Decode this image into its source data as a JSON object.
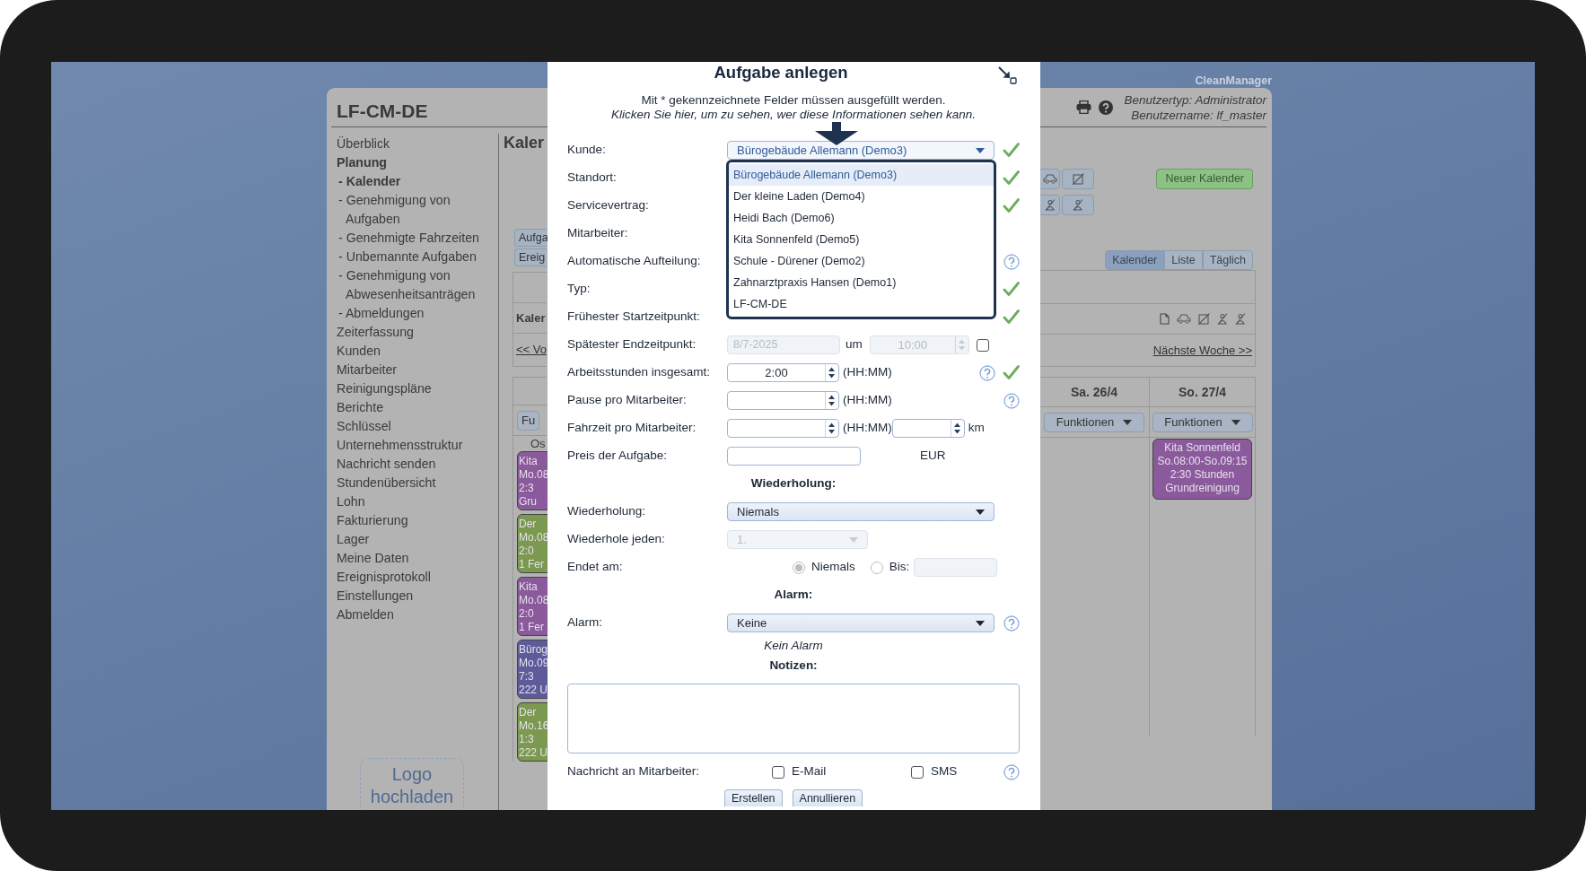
{
  "frame": {
    "brand": "CleanManager"
  },
  "app": {
    "title": "LF-CM-DE",
    "user_type": "Benutzertyp: Administrator",
    "user_name": "Benutzername: lf_master",
    "sidebar": {
      "items": [
        {
          "label": "Überblick",
          "selected": false
        },
        {
          "label": "Planung",
          "selected": true,
          "children": [
            {
              "label": "- Kalender",
              "selected": true
            },
            {
              "label": "- Genehmigung von Aufgaben",
              "selected": false
            },
            {
              "label": "- Genehmigte Fahrzeiten",
              "selected": false
            },
            {
              "label": "- Unbemannte Aufgaben",
              "selected": false
            },
            {
              "label": "- Genehmigung von Abwesenheitsanträgen",
              "selected": false
            },
            {
              "label": "- Abmeldungen",
              "selected": false
            }
          ]
        },
        {
          "label": "Zeiterfassung",
          "selected": false
        },
        {
          "label": "Kunden",
          "selected": false
        },
        {
          "label": "Mitarbeiter",
          "selected": false
        },
        {
          "label": "Reinigungspläne",
          "selected": false
        },
        {
          "label": "Berichte",
          "selected": false
        },
        {
          "label": "Schlüssel",
          "selected": false
        },
        {
          "label": "Unternehmensstruktur",
          "selected": false
        },
        {
          "label": "Nachricht senden",
          "selected": false
        },
        {
          "label": "Stundenübersicht",
          "selected": false
        },
        {
          "label": "Lohn",
          "selected": false
        },
        {
          "label": "Fakturierung",
          "selected": false
        },
        {
          "label": "Lager",
          "selected": false
        },
        {
          "label": "Meine Daten",
          "selected": false
        },
        {
          "label": "Ereignisprotokoll",
          "selected": false
        },
        {
          "label": "Einstellungen",
          "selected": false
        },
        {
          "label": "Abmelden",
          "selected": false
        }
      ],
      "logo_upload": "Logo hochladen"
    },
    "calendar_left": {
      "title": "Kaler",
      "buttons": [
        "Aufga",
        "Ereig"
      ],
      "subtitle": "Kaler",
      "prev_link": "<< Vo",
      "day_menu": "Fu",
      "row_label": "Os",
      "events": [
        {
          "lines": [
            "Kita",
            "Mo.08",
            "2:3",
            "Gru"
          ],
          "color": "#8b5a9c"
        },
        {
          "lines": [
            "Der",
            "Mo.08",
            "2:0",
            "1 Fer"
          ],
          "color": "#7b9950"
        },
        {
          "lines": [
            "Kita",
            "Mo.08",
            "2:0",
            "1 Fer"
          ],
          "color": "#8b5a9c"
        },
        {
          "lines": [
            "Bürog",
            "Mo.09",
            "7:3",
            "222 U"
          ],
          "color": "#5e5b9b"
        },
        {
          "lines": [
            "Der",
            "Mo.16",
            "1:3",
            "222 U"
          ],
          "color": "#7b9950"
        }
      ]
    },
    "calendar_right": {
      "new_calendar": "Neuer Kalender",
      "view_tabs": [
        {
          "label": "Kalender",
          "selected": true
        },
        {
          "label": "Liste",
          "selected": false
        },
        {
          "label": "Täglich",
          "selected": false
        }
      ],
      "next_link": "Nächste Woche >>",
      "days": [
        {
          "header": "Sa. 26/4",
          "menu": "Funktionen"
        },
        {
          "header": "So. 27/4",
          "menu": "Funktionen",
          "events": [
            {
              "lines": [
                "Kita Sonnenfeld",
                "So.08:00-So.09:15",
                "2:30 Stunden",
                "Grundreinigung"
              ],
              "color": "#8b5a9c"
            }
          ]
        }
      ]
    }
  },
  "dialog": {
    "title": "Aufgabe anlegen",
    "note": "Mit * gekennzeichnete Felder müssen ausgefüllt werden.",
    "visibility_link": "Klicken Sie hier, um zu sehen, wer diese Informationen sehen kann.",
    "fields": [
      {
        "kind": "select",
        "label": "Kunde:",
        "value": "Bürogebäude Allemann (Demo3)",
        "open": true,
        "valid": true,
        "options": [
          {
            "label": "Bürogebäude Allemann (Demo3)",
            "selected": true
          },
          {
            "label": "Der kleine Laden (Demo4)",
            "selected": false
          },
          {
            "label": "Heidi Bach (Demo6)",
            "selected": false
          },
          {
            "label": "Kita Sonnenfeld (Demo5)",
            "selected": false
          },
          {
            "label": "Schule - Dürener (Demo2)",
            "selected": false
          },
          {
            "label": "Zahnarztpraxis Hansen (Demo1)",
            "selected": false
          },
          {
            "label": "LF-CM-DE",
            "selected": false
          }
        ]
      },
      {
        "kind": "label",
        "label": "Standort:",
        "valid": true
      },
      {
        "kind": "label",
        "label": "Servicevertrag:",
        "valid": true
      },
      {
        "kind": "label",
        "label": "Mitarbeiter:"
      },
      {
        "kind": "label",
        "label": "Automatische Aufteilung:",
        "help": true
      },
      {
        "kind": "label",
        "label": "Typ:",
        "valid": true
      },
      {
        "kind": "label",
        "label": "Frühester Startzeitpunkt:",
        "valid": true
      },
      {
        "kind": "datetime",
        "label": "Spätester Endzeitpunkt:",
        "date": "8/7-2025",
        "connector": "um",
        "time": "10:00",
        "disabled": true,
        "checked": false
      },
      {
        "kind": "duration",
        "label": "Arbeitsstunden insgesamt:",
        "value": "2:00",
        "unit": "(HH:MM)",
        "help": true,
        "valid": true
      },
      {
        "kind": "duration",
        "label": "Pause pro Mitarbeiter:",
        "unit": "(HH:MM)",
        "help": true
      },
      {
        "kind": "duration_distance",
        "label": "Fahrzeit pro Mitarbeiter:",
        "unit": "(HH:MM)",
        "distance_unit": "km"
      },
      {
        "kind": "price",
        "label": "Preis der Aufgabe:",
        "unit": "EUR"
      },
      {
        "kind": "heading",
        "label": "Wiederholung:"
      },
      {
        "kind": "select",
        "label": "Wiederholung:",
        "value": "Niemals"
      },
      {
        "kind": "select",
        "label": "Wiederhole jeden:",
        "value": "1.",
        "disabled": true
      },
      {
        "kind": "radios",
        "label": "Endet am:",
        "disabled": true,
        "options": [
          {
            "label": "Niemals",
            "selected": true
          },
          {
            "label": "Bis:",
            "selected": false
          }
        ]
      },
      {
        "kind": "heading",
        "label": "Alarm:"
      },
      {
        "kind": "select",
        "label": "Alarm:",
        "value": "Keine",
        "help": true
      },
      {
        "kind": "note",
        "label": "Kein Alarm"
      },
      {
        "kind": "heading",
        "label": "Notizen:"
      },
      {
        "kind": "textarea"
      },
      {
        "kind": "checks",
        "label": "Nachricht an Mitarbeiter:",
        "help": true,
        "options": [
          {
            "label": "E-Mail",
            "checked": false
          },
          {
            "label": "SMS",
            "checked": false
          }
        ]
      }
    ],
    "buttons": [
      "Erstellen",
      "Annullieren"
    ]
  }
}
